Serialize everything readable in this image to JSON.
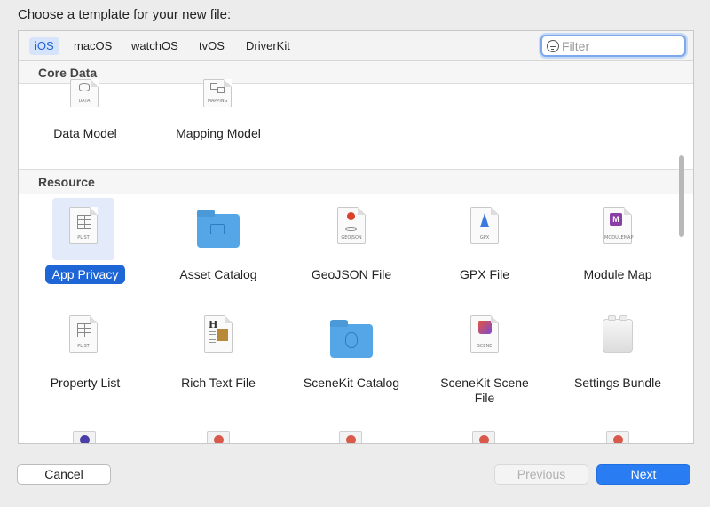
{
  "dialog": {
    "title": "Choose a template for your new file:"
  },
  "tabs": [
    {
      "label": "iOS",
      "active": true
    },
    {
      "label": "macOS"
    },
    {
      "label": "watchOS"
    },
    {
      "label": "tvOS"
    },
    {
      "label": "DriverKit"
    }
  ],
  "filter": {
    "placeholder": "Filter",
    "value": ""
  },
  "sections": {
    "core_data": {
      "header": "Core Data",
      "items": [
        {
          "label": "Data Model",
          "icon": "data-model-icon",
          "icon_caption": "DATA"
        },
        {
          "label": "Mapping Model",
          "icon": "mapping-model-icon",
          "icon_caption": "MAPPING"
        }
      ]
    },
    "resource": {
      "header": "Resource",
      "items": [
        {
          "label": "App Privacy",
          "icon": "plist-icon",
          "icon_caption": "PLIST",
          "selected": true
        },
        {
          "label": "Asset Catalog",
          "icon": "asset-catalog-folder-icon"
        },
        {
          "label": "GeoJSON File",
          "icon": "geojson-icon",
          "icon_caption": "GEOJSON"
        },
        {
          "label": "GPX File",
          "icon": "gpx-icon",
          "icon_caption": "GPX"
        },
        {
          "label": "Module Map",
          "icon": "module-map-icon",
          "icon_caption": "MODULEMAP"
        },
        {
          "label": "Property List",
          "icon": "plist-icon",
          "icon_caption": "PLIST"
        },
        {
          "label": "Rich Text File",
          "icon": "rich-text-icon"
        },
        {
          "label": "SceneKit Catalog",
          "icon": "scenekit-catalog-folder-icon"
        },
        {
          "label": "SceneKit Scene File",
          "label_line1": "SceneKit Scene",
          "label_line2": "File",
          "icon": "scene-icon",
          "icon_caption": "SCENE"
        },
        {
          "label": "Settings Bundle",
          "icon": "settings-bundle-lego-icon"
        }
      ]
    }
  },
  "buttons": {
    "cancel": "Cancel",
    "previous": "Previous",
    "next": "Next"
  },
  "colors": {
    "accent": "#2a7cf2",
    "selection": "#1e66d6",
    "folder": "#55a6e6"
  }
}
